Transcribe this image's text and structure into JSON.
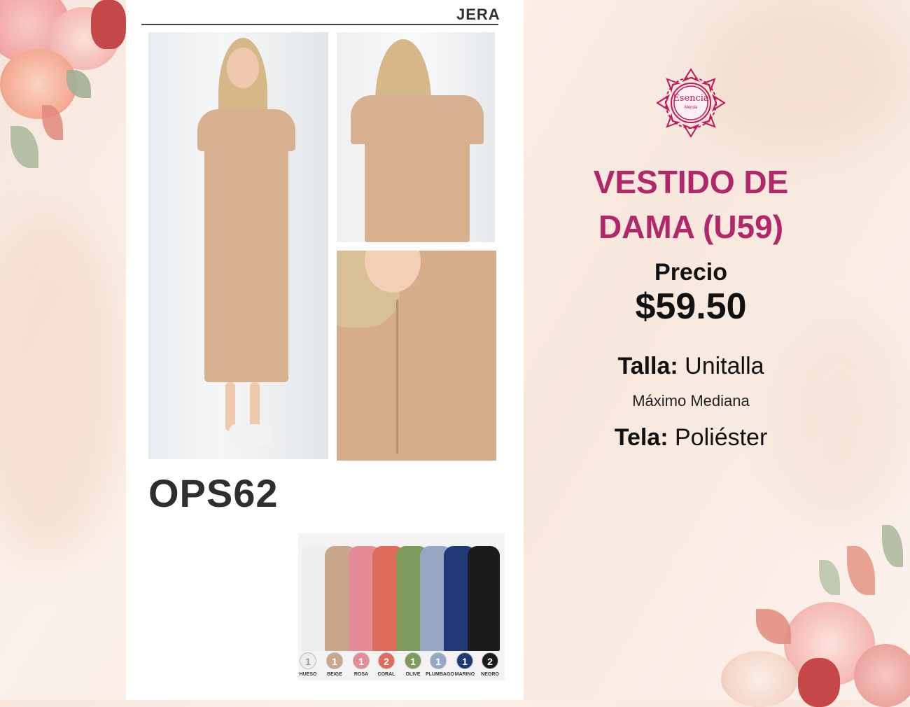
{
  "catalog": {
    "header_brand": "JERA",
    "model_code": "OPS62",
    "colors": [
      {
        "count": "1",
        "name": "HUESO",
        "hex": "#eeeeec"
      },
      {
        "count": "1",
        "name": "BEIGE",
        "hex": "#c9a78a"
      },
      {
        "count": "1",
        "name": "ROSA",
        "hex": "#e58b98"
      },
      {
        "count": "2",
        "name": "CORAL",
        "hex": "#e06b5d"
      },
      {
        "count": "1",
        "name": "OLIVE",
        "hex": "#7e9a5c"
      },
      {
        "count": "1",
        "name": "PLUMBAGO",
        "hex": "#96a7c4"
      },
      {
        "count": "1",
        "name": "MARINO",
        "hex": "#203a78"
      },
      {
        "count": "2",
        "name": "NEGRO",
        "hex": "#1b1b1b"
      }
    ]
  },
  "logo": {
    "name": "Esencia",
    "subtitle": "Mérida",
    "color": "#c2185b"
  },
  "product": {
    "title_line1": "VESTIDO DE",
    "title_line2": "DAMA (U59)",
    "price_label": "Precio",
    "price": "$59.50",
    "size_label": "Talla:",
    "size_value": " Unitalla",
    "size_note": "Máximo Mediana",
    "fabric_label": "Tela:",
    "fabric_value": " Poliéster",
    "accent_color": "#b0286a"
  }
}
